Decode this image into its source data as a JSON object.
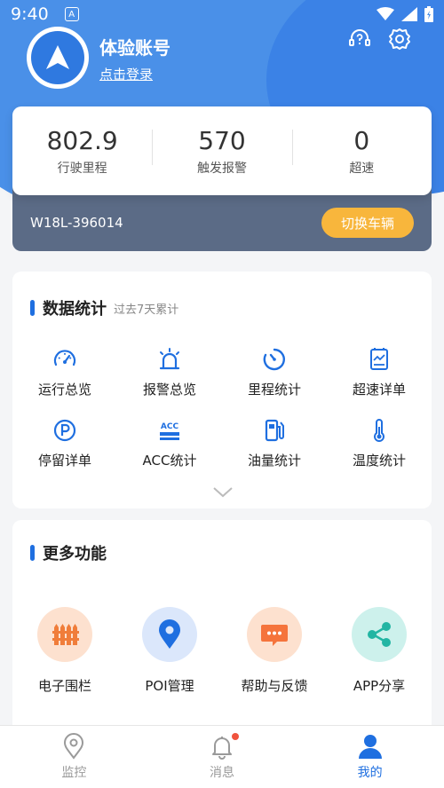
{
  "status_bar": {
    "time": "9:40",
    "notif_badge": "A"
  },
  "profile": {
    "name": "体验账号",
    "login_link": "点击登录"
  },
  "icons": {
    "help": "headset-question-icon",
    "settings": "gear-icon"
  },
  "stats": [
    {
      "value": "802.9",
      "label": "行驶里程"
    },
    {
      "value": "570",
      "label": "触发报警"
    },
    {
      "value": "0",
      "label": "超速"
    }
  ],
  "vehicle": {
    "plate": "W18L-396014",
    "switch_label": "切换车辆"
  },
  "data_stats": {
    "title": "数据统计",
    "subtitle": "过去7天累计",
    "items": [
      {
        "label": "运行总览",
        "icon": "speedometer-icon"
      },
      {
        "label": "报警总览",
        "icon": "alarm-light-icon"
      },
      {
        "label": "里程统计",
        "icon": "timer-icon"
      },
      {
        "label": "超速详单",
        "icon": "chart-report-icon"
      },
      {
        "label": "停留详单",
        "icon": "parking-icon"
      },
      {
        "label": "ACC统计",
        "icon": "acc-icon",
        "icon_text": "ACC"
      },
      {
        "label": "油量统计",
        "icon": "fuel-pump-icon"
      },
      {
        "label": "温度统计",
        "icon": "thermometer-icon"
      }
    ]
  },
  "more": {
    "title": "更多功能",
    "items": [
      {
        "label": "电子围栏",
        "icon": "fence-icon",
        "bg": "#fde1cf",
        "fg": "#f07d3a"
      },
      {
        "label": "POI管理",
        "icon": "location-pin-icon",
        "bg": "#dbe7fb",
        "fg": "#1f6fe0"
      },
      {
        "label": "帮助与反馈",
        "icon": "chat-bubble-icon",
        "bg": "#fde1cf",
        "fg": "#f5743c"
      },
      {
        "label": "APP分享",
        "icon": "share-icon",
        "bg": "#cdf1ec",
        "fg": "#22b5a3"
      }
    ]
  },
  "tabs": [
    {
      "label": "监控",
      "icon": "location-pin-icon",
      "active": false
    },
    {
      "label": "消息",
      "icon": "bell-icon",
      "active": false,
      "badge": true
    },
    {
      "label": "我的",
      "icon": "user-icon",
      "active": true
    }
  ],
  "colors": {
    "primary": "#1f6fe0",
    "accent": "#f8b63c",
    "hero": "#4a90e8",
    "vehicle_bar": "#5b6b86"
  }
}
